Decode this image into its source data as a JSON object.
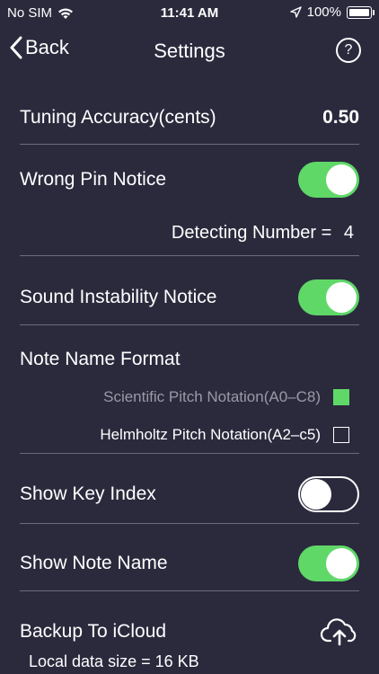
{
  "status_bar": {
    "carrier": "No SIM",
    "time": "11:41 AM",
    "battery": "100%",
    "icons": [
      "wifi-icon",
      "location-arrow-icon",
      "battery-icon"
    ]
  },
  "nav": {
    "back_label": "Back",
    "title": "Settings",
    "help_label": "?"
  },
  "settings": {
    "tuning_label": "Tuning Accuracy(cents)",
    "tuning_value": "0.50",
    "wrong_pin_label": "Wrong Pin Notice",
    "wrong_pin_on": true,
    "detecting_label": "Detecting Number =",
    "detecting_value": "4",
    "sound_instability_label": "Sound Instability Notice",
    "sound_instability_on": true,
    "note_format_label": "Note Name Format",
    "note_format_options": [
      {
        "label": "Scientific Pitch Notation(A0–C8)",
        "checked": true
      },
      {
        "label": "Helmholtz Pitch Notation(A2–c5)",
        "checked": false
      }
    ],
    "show_key_index_label": "Show Key Index",
    "show_key_index_on": false,
    "show_note_name_label": "Show Note Name",
    "show_note_name_on": true,
    "backup_label": "Backup To iCloud",
    "local_data_label": "Local data size = 16 KB"
  },
  "colors": {
    "background": "#2b2a3d",
    "toggle_on": "#5fd868",
    "divider": "#6c6b7d",
    "muted_text": "#9a99a6"
  }
}
